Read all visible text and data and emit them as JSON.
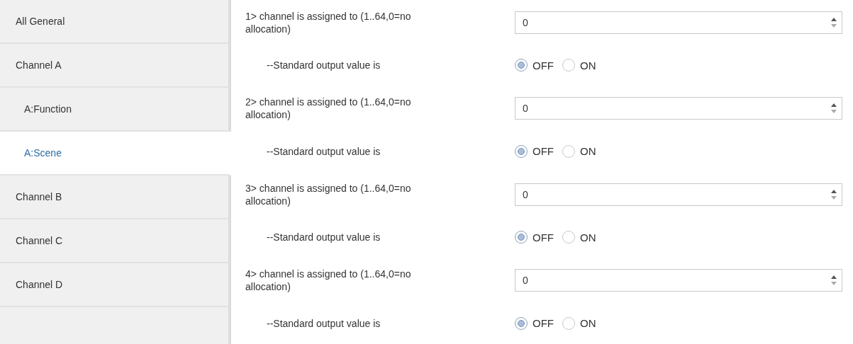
{
  "sidebar": {
    "items": [
      {
        "label": "All General",
        "selected": false
      },
      {
        "label": "Channel A",
        "selected": false,
        "children": [
          {
            "label": "A:Function",
            "selected": false
          },
          {
            "label": "A:Scene",
            "selected": true
          }
        ]
      },
      {
        "label": "Channel B",
        "selected": false
      },
      {
        "label": "Channel C",
        "selected": false
      },
      {
        "label": "Channel D",
        "selected": false
      }
    ]
  },
  "parameters": [
    {
      "kind": "number",
      "label": "1> channel is assigned to (1..64,0=no allocation)",
      "value": "0"
    },
    {
      "kind": "radio",
      "label": "--Standard output value is",
      "options": [
        {
          "label": "OFF",
          "selected": true
        },
        {
          "label": "ON",
          "selected": false
        }
      ]
    },
    {
      "kind": "number",
      "label": "2> channel is assigned to (1..64,0=no allocation)",
      "value": "0"
    },
    {
      "kind": "radio",
      "label": "--Standard output value is",
      "options": [
        {
          "label": "OFF",
          "selected": true
        },
        {
          "label": "ON",
          "selected": false
        }
      ]
    },
    {
      "kind": "number",
      "label": "3> channel is assigned to (1..64,0=no allocation)",
      "value": "0"
    },
    {
      "kind": "radio",
      "label": "--Standard output value is",
      "options": [
        {
          "label": "OFF",
          "selected": true
        },
        {
          "label": "ON",
          "selected": false
        }
      ]
    },
    {
      "kind": "number",
      "label": "4> channel is assigned to (1..64,0=no allocation)",
      "value": "0"
    },
    {
      "kind": "radio",
      "label": "--Standard output value is",
      "options": [
        {
          "label": "OFF",
          "selected": true
        },
        {
          "label": "ON",
          "selected": false
        }
      ]
    }
  ]
}
